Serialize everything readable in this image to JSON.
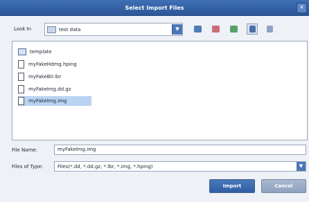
{
  "dialog": {
    "title": "Select Import Files"
  },
  "look_in": {
    "label": "Look In",
    "folder": "test data",
    "toolbar_icons": [
      "up-folder-icon",
      "home-icon",
      "new-folder-icon",
      "list-view-icon",
      "details-view-icon"
    ]
  },
  "files": [
    {
      "name": "template",
      "kind": "folder",
      "selected": false
    },
    {
      "name": "myFakeHdmg.hping",
      "kind": "file",
      "selected": false
    },
    {
      "name": "myFakeBlr.lbr",
      "kind": "file",
      "selected": false
    },
    {
      "name": "myFakeImg.dd.gz",
      "kind": "file",
      "selected": false
    },
    {
      "name": "myFakeImg.img",
      "kind": "file",
      "selected": true
    }
  ],
  "file_name": {
    "label": "File Name:",
    "value": "myFakeImg.img"
  },
  "files_of_type": {
    "label": "Files of Type:",
    "value": "Files(*.dd, *.dd.gz, *.lbr, *.img, *.hping)"
  },
  "buttons": {
    "import": "Import",
    "cancel": "Cancel"
  },
  "colors": {
    "title_bar": "#2c5799",
    "selection": "#b9d3f2",
    "import_button": "#2f5fa3",
    "cancel_button": "#8fa1bd"
  }
}
